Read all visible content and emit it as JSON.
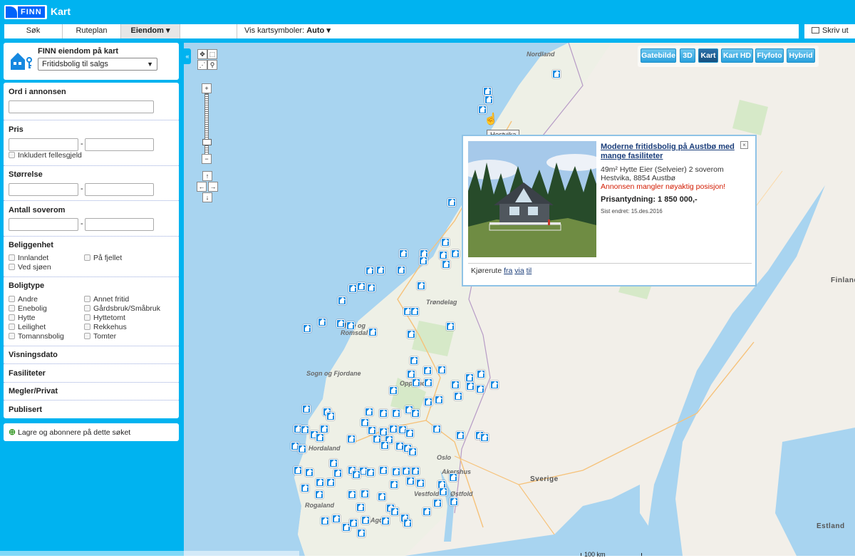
{
  "header": {
    "logo_text": "FINN",
    "app_title": "Kart"
  },
  "nav": {
    "tabs": [
      {
        "label": "Søk"
      },
      {
        "label": "Ruteplan"
      },
      {
        "label": "Eiendom ▾"
      }
    ],
    "symbols_label": "Vis kartsymboler:",
    "symbols_value": "Auto ▾",
    "print_label": "Skriv ut"
  },
  "sidebar": {
    "title": "FINN eiendom på kart",
    "category_select": "Fritidsbolig til salgs",
    "sections": {
      "keywords": "Ord i annonsen",
      "price": "Pris",
      "price_shared_debt": "Inkludert fellesgjeld",
      "size": "Størrelse",
      "bedrooms": "Antall soverom",
      "location": "Beliggenhet",
      "property_type": "Boligtype",
      "viewing_date": "Visningsdato",
      "facilities": "Fasiliteter",
      "agent": "Megler/Privat",
      "published": "Publisert",
      "range_dash": "-"
    },
    "location_options": [
      "Innlandet",
      "På fjellet",
      "Ved sjøen"
    ],
    "type_options": [
      "Andre",
      "Annet fritid",
      "Enebolig",
      "Gårdsbruk/Småbruk",
      "Hytte",
      "Hyttetomt",
      "Leilighet",
      "Rekkehus",
      "Tomannsbolig",
      "Tomter"
    ],
    "save_search": "Lagre og abonnere på dette søket"
  },
  "map": {
    "types": [
      "Gatebilde",
      "3D",
      "Kart",
      "Kart HD",
      "Flyfoto",
      "Hybrid"
    ],
    "active_type": "Kart",
    "labels": {
      "nordland": "Nordland",
      "trondelag": "Trøndelag",
      "more": "Møre og Romsdal",
      "sogn": "Sogn og Fjordane",
      "oppland": "Oppland",
      "hordaland": "Hordaland",
      "oslo": "Oslo",
      "akershus": "Akershus",
      "ostfold": "Østfold",
      "vestfold": "Vestfold",
      "rogaland": "Rogaland",
      "agder": "Agder",
      "sverige": "Sverige",
      "finland": "Finland",
      "estland": "Estland"
    },
    "tooltip": "Hestvika",
    "scale": "100 km",
    "zoom_in": "+",
    "zoom_out": "−"
  },
  "popup": {
    "title": "Moderne fritidsbolig på Austbø med mange fasiliteter",
    "details": "49m²   Hytte   Eier (Selveier)   2 soverom",
    "address": "Hestvika, 8854 Austbø",
    "warning": "Annonsen mangler nøyaktig posisjon!",
    "price": "Prisantydning:  1 850 000,-",
    "changed": "Sist endret:   15.des.2016",
    "route_label": "Kjørerute",
    "route_from": "fra",
    "route_via": "via",
    "route_to": "til",
    "close": "×"
  },
  "colors": {
    "brand": "#00b3f0",
    "finn_blue": "#0063fb",
    "pin": "#1588e0",
    "warning": "#d21a00"
  }
}
